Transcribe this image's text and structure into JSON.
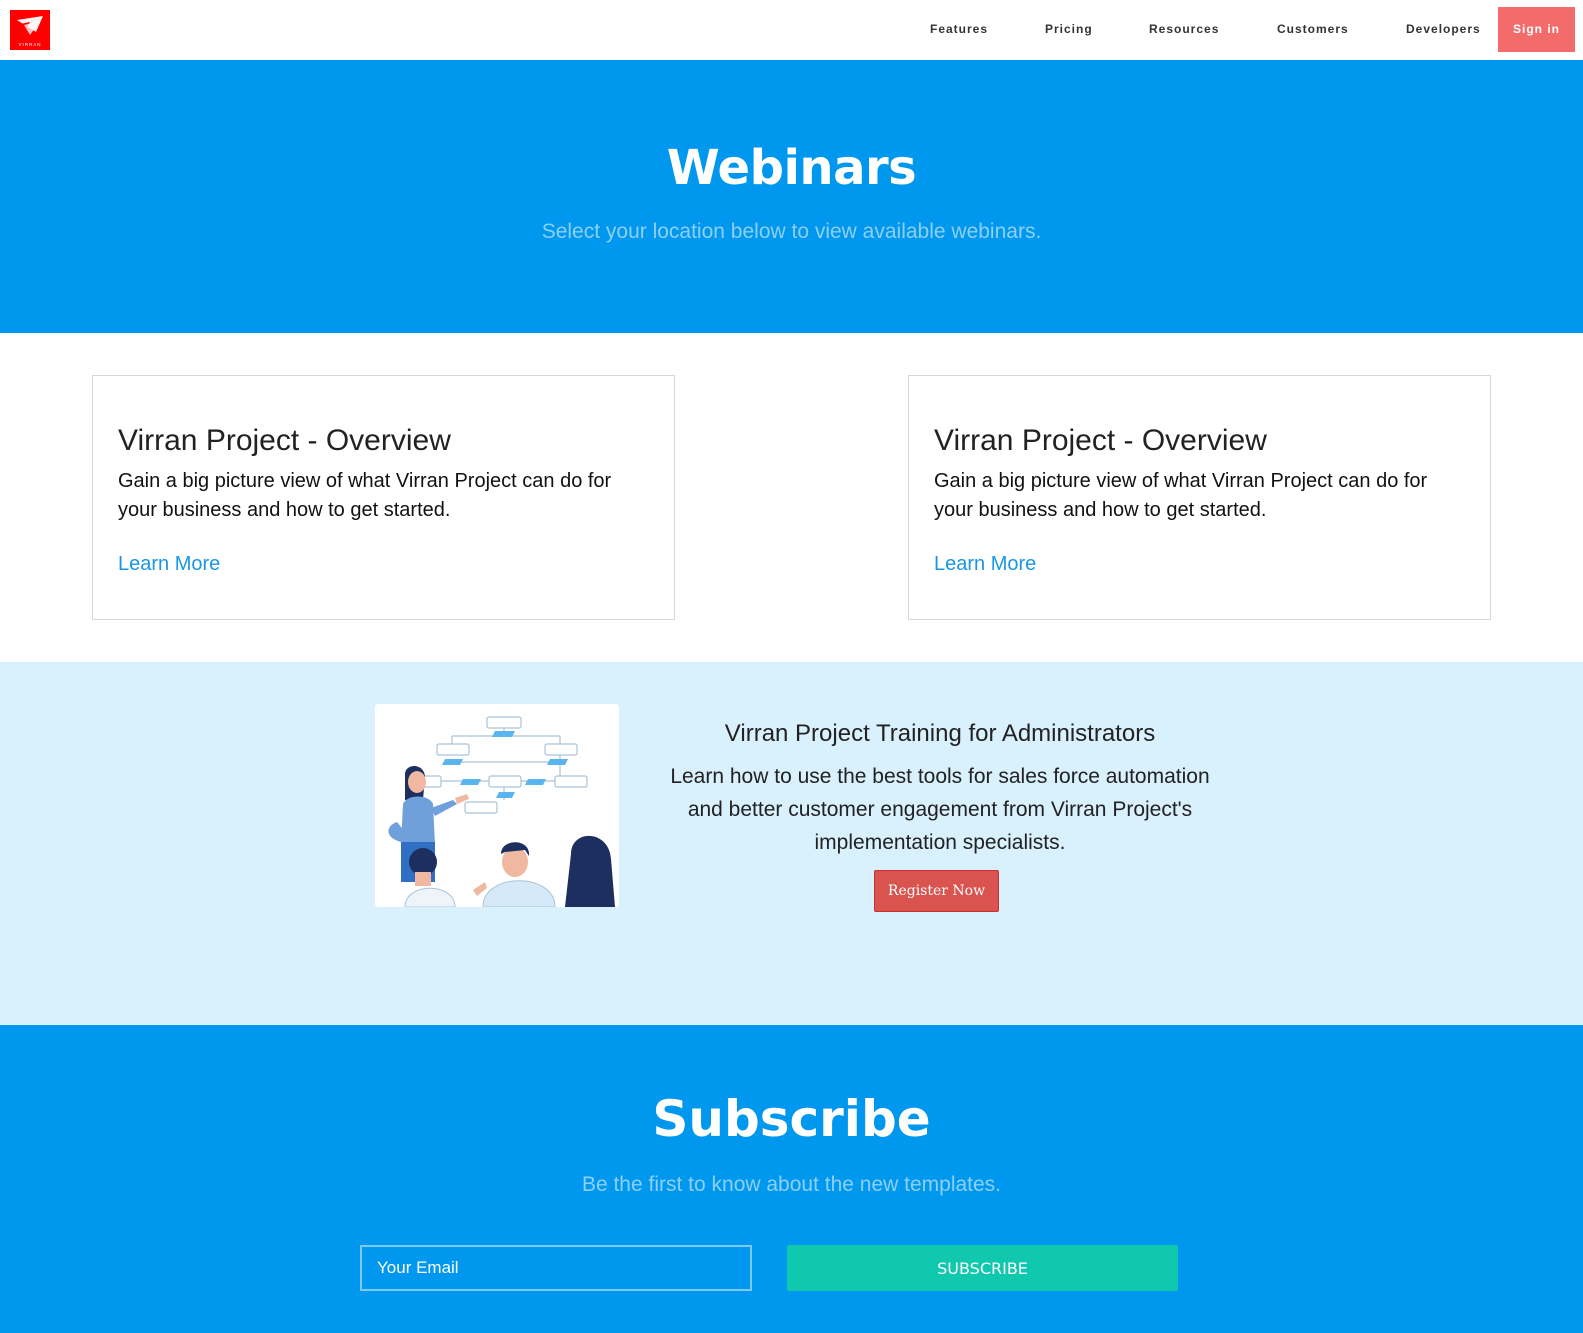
{
  "header": {
    "logo_text": "VIRRAN",
    "nav": [
      "Features",
      "Pricing",
      "Resources",
      "Customers",
      "Developers"
    ],
    "signin_label": "Sign in"
  },
  "hero": {
    "title": "Webinars",
    "subtitle": "Select your location below to view available webinars."
  },
  "cards": [
    {
      "title": "Virran Project - Overview",
      "description": "Gain a big picture view of what Virran Project can do for your business and how to get started.",
      "link": "Learn More"
    },
    {
      "title": "Virran Project - Overview",
      "description": "Gain a big picture view of what Virran Project can do for your business and how to get started.",
      "link": "Learn More"
    }
  ],
  "training": {
    "title": "Virran Project Training for Administrators",
    "description": "Learn how to use the best tools for sales force automation and better customer engagement from Virran Project's implementation specialists.",
    "button": "Register Now"
  },
  "subscribe": {
    "title": "Subscribe",
    "subtitle": "Be the first to know about the new templates.",
    "email_placeholder": "Your Email",
    "button": "SUBSCRIBE"
  },
  "colors": {
    "brand_blue": "#0097ee",
    "light_blue": "#d9f0fd",
    "signin": "#f46b6b",
    "register": "#d9534f",
    "subscribe_button": "#10c8ad",
    "link": "#1997e6"
  }
}
